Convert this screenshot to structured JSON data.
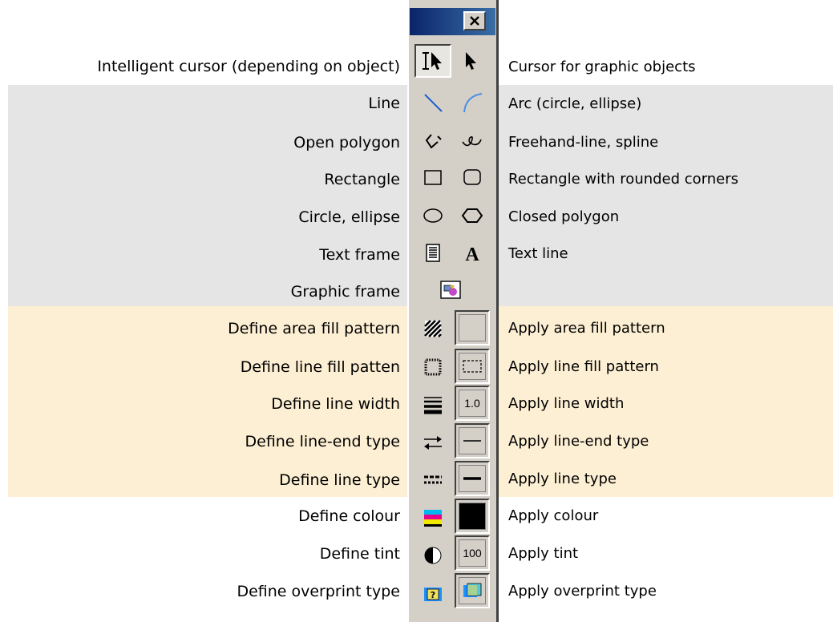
{
  "window": {
    "close_label": "×"
  },
  "rows": [
    {
      "left": "Intelligent cursor (depending on object)",
      "right": "Cursor for graphic objects",
      "left_icon": "intelligent-cursor-icon",
      "right_icon": "arrow-cursor-icon"
    },
    {
      "left": "Line",
      "right": "Arc (circle, ellipse)",
      "left_icon": "line-icon",
      "right_icon": "arc-icon"
    },
    {
      "left": "Open polygon",
      "right": "Freehand-line, spline",
      "left_icon": "open-polygon-icon",
      "right_icon": "freehand-icon"
    },
    {
      "left": "Rectangle",
      "right": "Rectangle with rounded corners",
      "left_icon": "rectangle-icon",
      "right_icon": "rounded-rectangle-icon"
    },
    {
      "left": "Circle, ellipse",
      "right": "Closed polygon",
      "left_icon": "ellipse-icon",
      "right_icon": "closed-polygon-icon"
    },
    {
      "left": "Text frame",
      "right": "Text line",
      "left_icon": "text-frame-icon",
      "right_icon": "text-line-icon"
    },
    {
      "left": "Graphic frame",
      "right": "",
      "left_icon": "graphic-frame-icon",
      "right_icon": ""
    },
    {
      "left": "Define area fill pattern",
      "right": "Apply area fill pattern",
      "left_icon": "area-fill-pattern-icon",
      "right_icon": "apply-area-fill-slot"
    },
    {
      "left": "Define line fill patten",
      "right": "Apply line fill pattern",
      "left_icon": "line-fill-pattern-icon",
      "right_icon": "apply-line-fill-slot"
    },
    {
      "left": "Define line width",
      "right": "Apply line width",
      "left_icon": "line-width-icon",
      "right_icon": "apply-line-width-slot"
    },
    {
      "left": "Define line-end type",
      "right": "Apply line-end type",
      "left_icon": "line-end-icon",
      "right_icon": "apply-line-end-slot"
    },
    {
      "left": "Define line type",
      "right": "Apply line type",
      "left_icon": "line-type-icon",
      "right_icon": "apply-line-type-slot"
    },
    {
      "left": "Define colour",
      "right": "Apply colour",
      "left_icon": "colour-icon",
      "right_icon": "apply-colour-slot"
    },
    {
      "left": "Define tint",
      "right": "Apply tint",
      "left_icon": "tint-icon",
      "right_icon": "apply-tint-slot"
    },
    {
      "left": "Define overprint type",
      "right": "Apply overprint type",
      "left_icon": "overprint-icon",
      "right_icon": "apply-overprint-slot"
    }
  ],
  "slots": {
    "line_width_value": "1.0",
    "tint_value": "100",
    "colour": "#000000"
  },
  "colors": {
    "grey_band": "#e5e5e5",
    "tan_band": "#fdefd3",
    "toolbar": "#d4d0c8",
    "titlebar_start": "#0a246a",
    "titlebar_end": "#3a6ea5"
  }
}
